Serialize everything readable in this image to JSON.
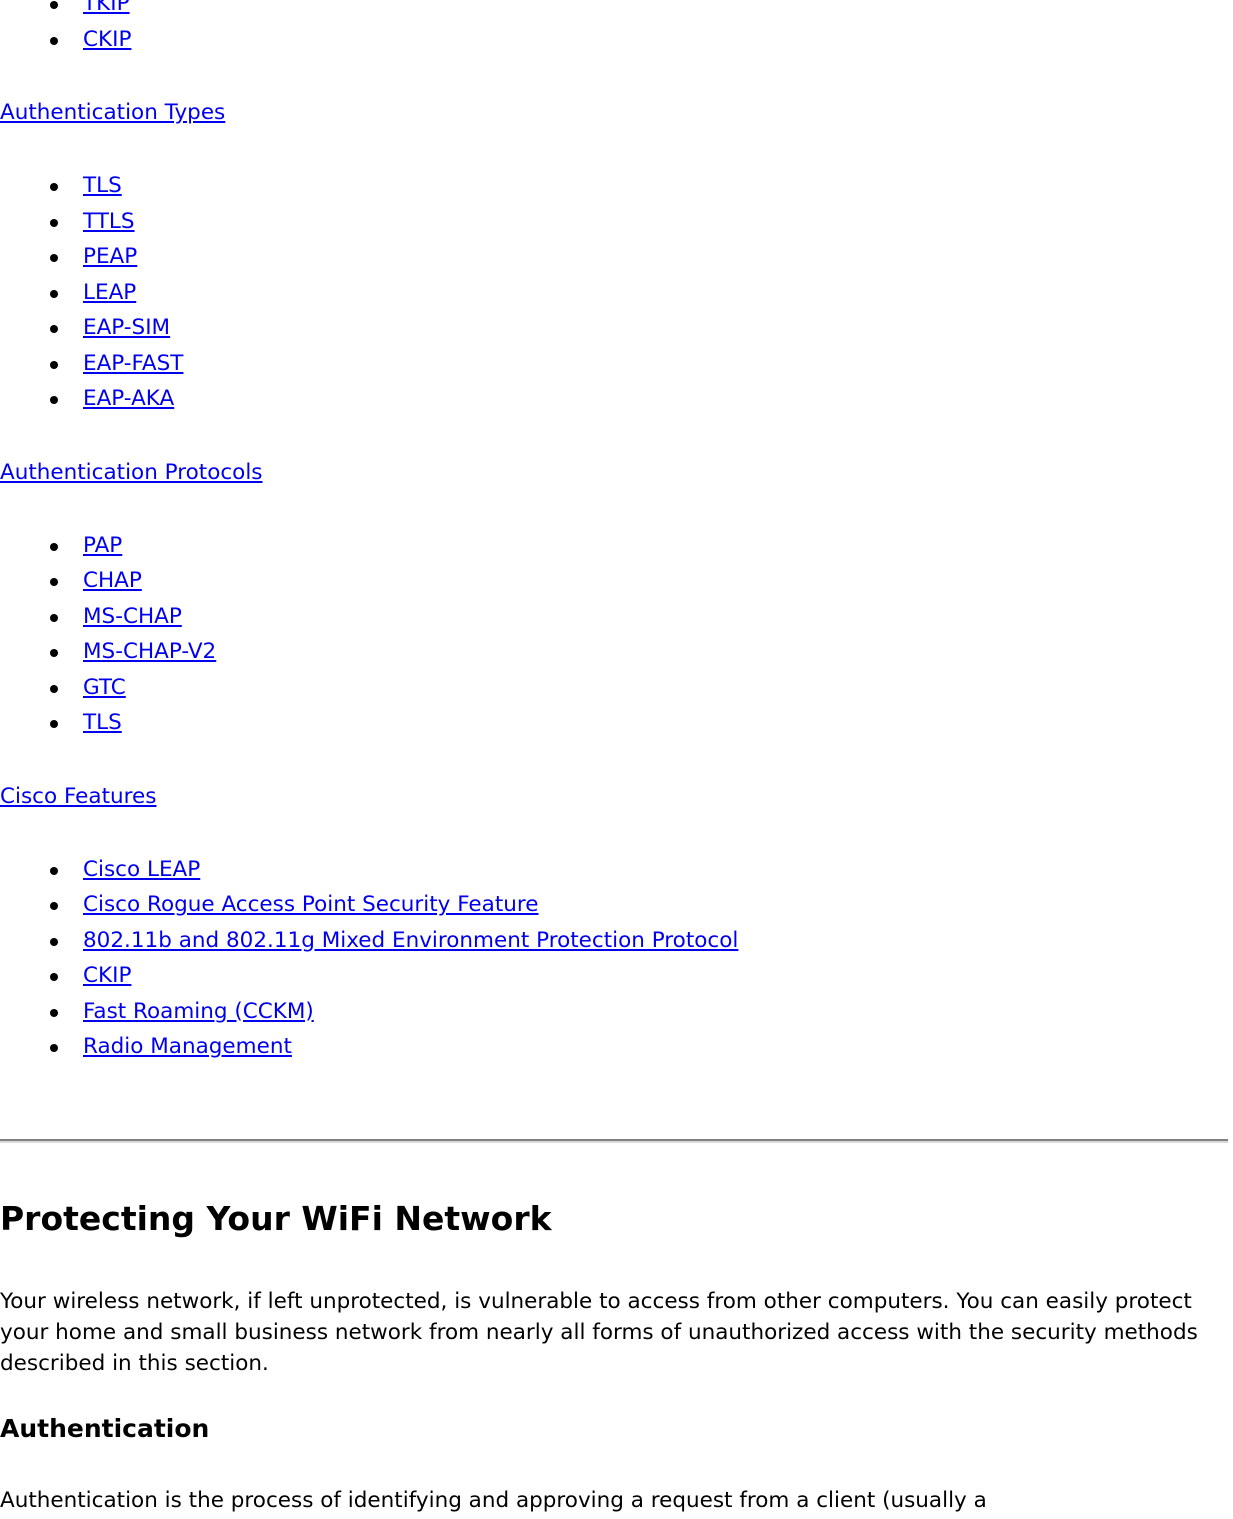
{
  "document": {
    "encryption_list_tail": [
      {
        "label": "TKIP"
      },
      {
        "label": "CKIP"
      }
    ],
    "sections": [
      {
        "heading": "Authentication Types",
        "items": [
          {
            "label": "TLS"
          },
          {
            "label": "TTLS"
          },
          {
            "label": "PEAP"
          },
          {
            "label": "LEAP"
          },
          {
            "label": "EAP-SIM"
          },
          {
            "label": "EAP-FAST"
          },
          {
            "label": "EAP-AKA"
          }
        ]
      },
      {
        "heading": "Authentication Protocols",
        "items": [
          {
            "label": "PAP"
          },
          {
            "label": "CHAP"
          },
          {
            "label": "MS-CHAP"
          },
          {
            "label": "MS-CHAP-V2"
          },
          {
            "label": "GTC"
          },
          {
            "label": "TLS"
          }
        ]
      },
      {
        "heading": "Cisco Features",
        "items": [
          {
            "label": "Cisco LEAP"
          },
          {
            "label": "Cisco Rogue Access Point Security Feature"
          },
          {
            "label": "802.11b and 802.11g Mixed Environment Protection Protocol"
          },
          {
            "label": "CKIP"
          },
          {
            "label": "Fast Roaming (CCKM)"
          },
          {
            "label": "Radio Management"
          }
        ]
      }
    ],
    "article": {
      "title": "Protecting Your WiFi Network",
      "intro": "Your wireless network, if left unprotected, is vulnerable to access from other computers. You can easily protect your home and small business network from nearly all forms of unauthorized access with the security methods described in this section.",
      "subtitle": "Authentication",
      "body": "Authentication is the process of identifying and approving a request from a client (usually a"
    }
  },
  "colors": {
    "link": "#0000EE",
    "text": "#000000",
    "background": "#FFFFFF",
    "rule_dark": "#808080",
    "rule_light": "#D9D9D9"
  }
}
